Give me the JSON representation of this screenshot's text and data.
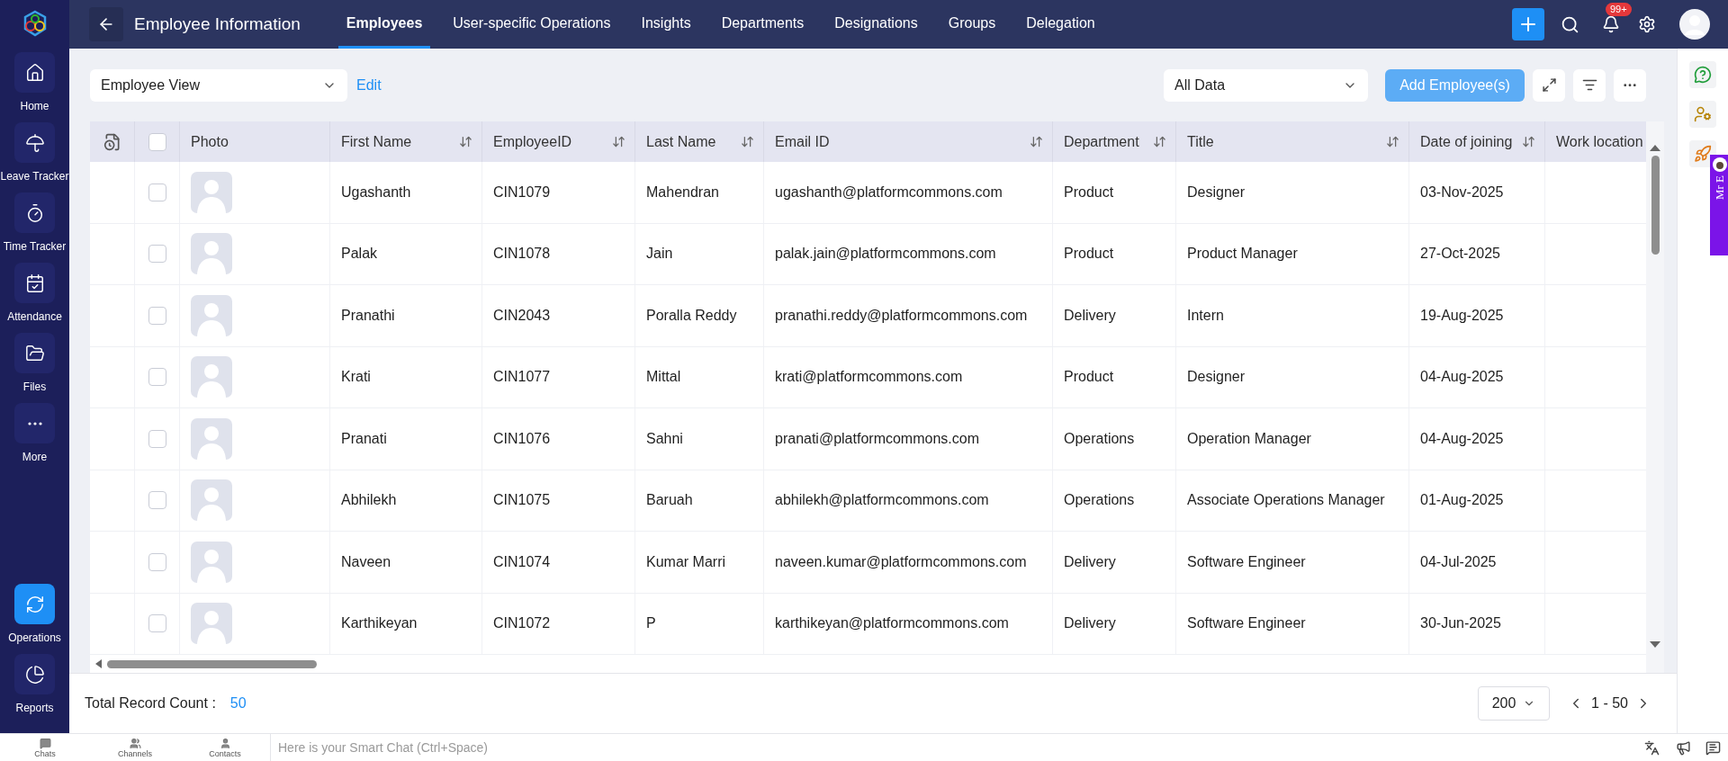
{
  "sidebar": {
    "items": [
      {
        "label": "Home",
        "selected": false
      },
      {
        "label": "Leave Tracker",
        "selected": false
      },
      {
        "label": "Time Tracker",
        "selected": false
      },
      {
        "label": "Attendance",
        "selected": false
      },
      {
        "label": "Files",
        "selected": false
      },
      {
        "label": "More",
        "selected": false
      },
      {
        "label": "Operations",
        "selected": true
      },
      {
        "label": "Reports",
        "selected": false
      }
    ]
  },
  "header": {
    "title": "Employee Information",
    "tabs": [
      {
        "label": "Employees",
        "selected": true
      },
      {
        "label": "User-specific Operations",
        "selected": false
      },
      {
        "label": "Insights",
        "selected": false
      },
      {
        "label": "Departments",
        "selected": false
      },
      {
        "label": "Designations",
        "selected": false
      },
      {
        "label": "Groups",
        "selected": false
      },
      {
        "label": "Delegation",
        "selected": false
      }
    ],
    "notification_badge": "99+"
  },
  "toolbar": {
    "view": "Employee View",
    "edit": "Edit",
    "filter": "All Data",
    "add_button": "Add Employee(s)"
  },
  "table": {
    "header_checked": false,
    "photo_column": "Photo",
    "columns": [
      {
        "label": "First Name",
        "sortable": true
      },
      {
        "label": "EmployeeID",
        "sortable": true
      },
      {
        "label": "Last Name",
        "sortable": true
      },
      {
        "label": "Email ID",
        "sortable": true
      },
      {
        "label": "Department",
        "sortable": true
      },
      {
        "label": "Title",
        "sortable": true
      },
      {
        "label": "Date of joining",
        "sortable": true
      },
      {
        "label": "Work location",
        "sortable": false
      }
    ],
    "rows": [
      {
        "checked": false,
        "cells": [
          "Ugashanth",
          "CIN1079",
          "Mahendran",
          "ugashanth@platformcommons.com",
          "Product",
          "Designer",
          "03-Nov-2025"
        ]
      },
      {
        "checked": false,
        "cells": [
          "Palak",
          "CIN1078",
          "Jain",
          "palak.jain@platformcommons.com",
          "Product",
          "Product Manager",
          "27-Oct-2025"
        ]
      },
      {
        "checked": false,
        "cells": [
          "Pranathi",
          "CIN2043",
          "Poralla Reddy",
          "pranathi.reddy@platformcommons.com",
          "Delivery",
          "Intern",
          "19-Aug-2025"
        ]
      },
      {
        "checked": false,
        "cells": [
          "Krati",
          "CIN1077",
          "Mittal",
          "krati@platformcommons.com",
          "Product",
          "Designer",
          "04-Aug-2025"
        ]
      },
      {
        "checked": false,
        "cells": [
          "Pranati",
          "CIN1076",
          "Sahni",
          "pranati@platformcommons.com",
          "Operations",
          "Operation Manager",
          "04-Aug-2025"
        ]
      },
      {
        "checked": false,
        "cells": [
          "Abhilekh",
          "CIN1075",
          "Baruah",
          "abhilekh@platformcommons.com",
          "Operations",
          "Associate Operations Manager",
          "01-Aug-2025"
        ]
      },
      {
        "checked": false,
        "cells": [
          "Naveen",
          "CIN1074",
          "Kumar Marri",
          "naveen.kumar@platformcommons.com",
          "Delivery",
          "Software Engineer",
          "04-Jul-2025"
        ]
      },
      {
        "checked": false,
        "cells": [
          "Karthikeyan",
          "CIN1072",
          "P",
          "karthikeyan@platformcommons.com",
          "Delivery",
          "Software Engineer",
          "30-Jun-2025"
        ]
      }
    ]
  },
  "footer": {
    "label": "Total Record Count :",
    "count": "50",
    "page_size": "200",
    "range": "1 - 50"
  },
  "side_tab": {
    "label": "Mr E"
  },
  "chat_bar": {
    "tabs": [
      {
        "label": "Chats"
      },
      {
        "label": "Channels"
      },
      {
        "label": "Contacts"
      }
    ],
    "placeholder": "Here is your Smart Chat (Ctrl+Space)"
  }
}
